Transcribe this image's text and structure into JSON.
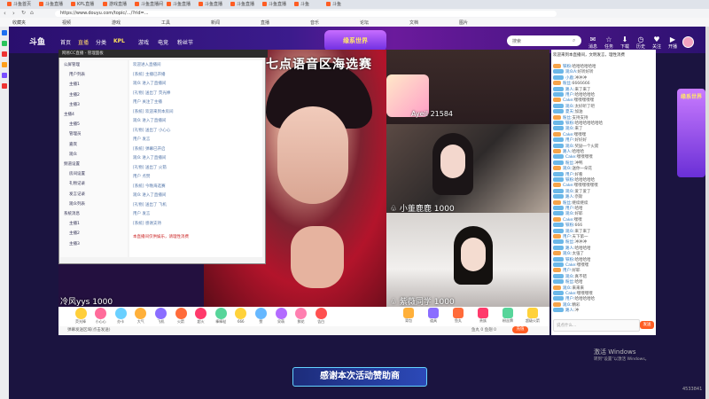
{
  "browser": {
    "tabs": [
      "斗鱼首页",
      "斗鱼直播",
      "KPL直播",
      "游戏直播",
      "斗鱼直播间",
      "斗鱼直播",
      "斗鱼直播",
      "斗鱼直播",
      "斗鱼直播",
      "斗鱼",
      "斗鱼"
    ],
    "url": "https://www.douyu.com/topic/.../?rid=...",
    "bookmarks": [
      "收藏夹",
      "视频",
      "游戏",
      "工具",
      "新闻",
      "直播",
      "音乐",
      "论坛",
      "文档",
      "图片"
    ]
  },
  "site": {
    "logo": "斗鱼",
    "nav": [
      "首页",
      "直播",
      "分类",
      "KPL",
      "游戏",
      "电竞",
      "粉丝节"
    ],
    "event_logo": "缘系世界",
    "search_placeholder": "搜索",
    "header_icons": [
      {
        "name": "消息",
        "glyph": "✉"
      },
      {
        "name": "任务",
        "glyph": "☆"
      },
      {
        "name": "下载",
        "glyph": "⬇"
      },
      {
        "name": "历史",
        "glyph": "◷"
      },
      {
        "name": "关注",
        "glyph": "♥"
      },
      {
        "name": "开播",
        "glyph": "▶"
      }
    ]
  },
  "player": {
    "overlay_title": "今晚七点语音区海选赛",
    "cam1_label": "♧ 小董鹿鹿 1000",
    "cam2_label": "♧ 紫薇同学 1000",
    "cam3_label": "冷风yys 1000",
    "stage_label": "Ayeil 21584",
    "pc_window_title": "网易CC直播 - 管理面板",
    "tree_items": [
      "公屏管理",
      "用户列表",
      "主播1",
      "主播2",
      "主播3",
      "主播4",
      "主播5",
      "管理员",
      "嘉宾",
      "观众",
      "频道设置",
      "房间设置",
      "礼物记录",
      "发言记录",
      "观众列表",
      "系统消息",
      "主播1",
      "主播2",
      "主播3"
    ],
    "log_lines": [
      "欢迎进入直播间",
      "[系统] 主播已开播",
      "观众 进入了直播间",
      "[礼物] 送出了 荧光棒",
      "用户 关注了主播",
      "[系统] 欢迎来到本房间",
      "观众 进入了直播间",
      "[礼物] 送出了 小心心",
      "用户 发言",
      "[系统] 弹幕已开启",
      "观众 进入了直播间",
      "[礼物] 送出了 火箭",
      "用户 点赞",
      "[系统] 今晚海选赛",
      "观众 进入了直播间",
      "[礼物] 送出了 飞机",
      "用户 发言",
      "[系统] 感谢支持"
    ],
    "notice": "本直播间仅供娱乐，请理性消费"
  },
  "gifts": [
    "荧光棒",
    "小心心",
    "办卡",
    "大气",
    "飞机",
    "火箭",
    "超火",
    "棒棒哒",
    "666",
    "赞",
    "呆萌",
    "鲜花",
    "告白"
  ],
  "right_gifts": [
    "背包",
    "道具",
    "鱼丸",
    "贵族",
    "粉丝牌",
    "超级火箭"
  ],
  "barrage_placeholder": "弹幕发送区域(点击发送)",
  "balance": "鱼丸 0  鱼翅 0",
  "recharge": "充值",
  "chat": {
    "notice": "欢迎来到本直播间，文明发言，理性消费",
    "messages": [
      {
        "user": "铁粉:",
        "text": "哈哈哈哈哈哈"
      },
      {
        "user": "观众A:",
        "text": "好听好听"
      },
      {
        "user": "小鹿:",
        "text": "冲冲冲"
      },
      {
        "user": "粉丝:",
        "text": "6666666"
      },
      {
        "user": "路人:",
        "text": "来了来了"
      },
      {
        "user": "用户:",
        "text": "哈哈哈哈哈"
      },
      {
        "user": "Cake:",
        "text": "嘿嘿嘿嘿嘿"
      },
      {
        "user": "观众:",
        "text": "太好听了吧"
      },
      {
        "user": "夏天:",
        "text": "加油"
      },
      {
        "user": "粉丝:",
        "text": "支持支持"
      },
      {
        "user": "铁粉:",
        "text": "哈哈哈哈哈哈哈"
      },
      {
        "user": "观众:",
        "text": "来了"
      },
      {
        "user": "Cake:",
        "text": "嘿嘿嘿"
      },
      {
        "user": "用户:",
        "text": "好好好"
      },
      {
        "user": "观众:",
        "text": "奖励一个火箭"
      },
      {
        "user": "路人:",
        "text": "哈哈哈"
      },
      {
        "user": "Cake:",
        "text": "嘿嘿嘿嘿"
      },
      {
        "user": "粉丝:",
        "text": "冲鸭"
      },
      {
        "user": "观众:",
        "text": "送你一朵花"
      },
      {
        "user": "用户:",
        "text": "好看"
      },
      {
        "user": "铁粉:",
        "text": "哈哈哈哈哈"
      },
      {
        "user": "Cake:",
        "text": "嘿嘿嘿嘿嘿嘿"
      },
      {
        "user": "观众:",
        "text": "爱了爱了"
      },
      {
        "user": "路人:",
        "text": "奈斯"
      },
      {
        "user": "粉丝:",
        "text": "继续继续"
      },
      {
        "user": "用户:",
        "text": "哈哈"
      },
      {
        "user": "观众:",
        "text": "好耶"
      },
      {
        "user": "Cake:",
        "text": "嘿嘿"
      },
      {
        "user": "铁粉:",
        "text": "666"
      },
      {
        "user": "观众:",
        "text": "来了来了"
      },
      {
        "user": "用户:",
        "text": "天下第一"
      },
      {
        "user": "粉丝:",
        "text": "冲冲冲"
      },
      {
        "user": "路人:",
        "text": "哈哈哈哈"
      },
      {
        "user": "观众:",
        "text": "太强了"
      },
      {
        "user": "铁粉:",
        "text": "哈哈哈哈"
      },
      {
        "user": "Cake:",
        "text": "嘿嘿嘿"
      },
      {
        "user": "用户:",
        "text": "好耶"
      },
      {
        "user": "观众:",
        "text": "真不错"
      },
      {
        "user": "粉丝:",
        "text": "哈哈"
      },
      {
        "user": "观众:",
        "text": "来来来"
      },
      {
        "user": "Cake:",
        "text": "嘿嘿嘿嘿"
      },
      {
        "user": "用户:",
        "text": "哈哈哈哈哈"
      },
      {
        "user": "观众:",
        "text": "精彩"
      },
      {
        "user": "路人:",
        "text": "冲"
      }
    ],
    "input_placeholder": "说点什么...",
    "send": "发送"
  },
  "right_ad": "缘系世界",
  "banner": "感谢本次活动赞助商",
  "activate_title": "激活 Windows",
  "activate_sub": "转到“设置”以激活 Windows。",
  "room_id": "4533841"
}
